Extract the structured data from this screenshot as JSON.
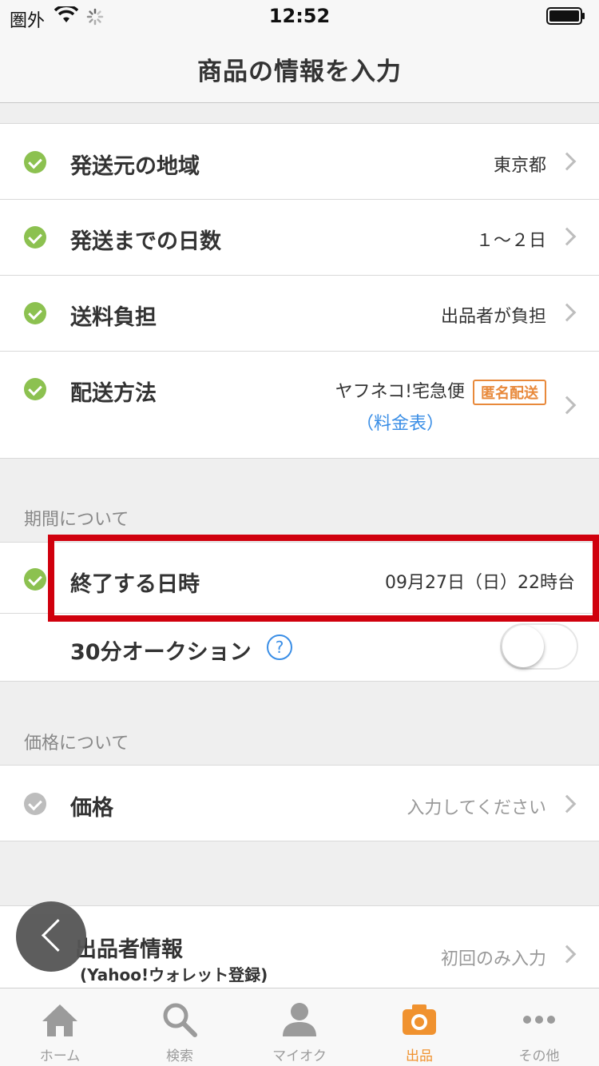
{
  "status": {
    "carrier": "圏外",
    "time": "12:52"
  },
  "nav": {
    "title": "商品の情報を入力"
  },
  "shipping": {
    "origin": {
      "label": "発送元の地域",
      "value": "東京都"
    },
    "days": {
      "label": "発送までの日数",
      "value": "１〜２日"
    },
    "fee": {
      "label": "送料負担",
      "value": "出品者が負担"
    },
    "method": {
      "label": "配送方法",
      "value": "ヤフネコ!宅急便",
      "badge": "匿名配送",
      "link": "（料金表）"
    }
  },
  "period": {
    "header": "期間について",
    "end": {
      "label": "終了する日時",
      "value": "09月27日（日）22時台"
    },
    "auction30": {
      "label": "30分オークション",
      "help": "?",
      "enabled": false
    }
  },
  "price": {
    "header": "価格について",
    "item": {
      "label": "価格",
      "placeholder": "入力してください"
    }
  },
  "seller": {
    "label": "出品者情報",
    "sublabel": "(Yahoo!ウォレット登録)",
    "value": "初回のみ入力"
  },
  "tabs": [
    {
      "label": "ホーム",
      "icon": "home-icon"
    },
    {
      "label": "検索",
      "icon": "search-icon"
    },
    {
      "label": "マイオク",
      "icon": "person-icon"
    },
    {
      "label": "出品",
      "icon": "camera-icon",
      "active": true
    },
    {
      "label": "その他",
      "icon": "more-icon"
    }
  ],
  "colors": {
    "accent": "#f0922f",
    "check": "#8cc150",
    "highlight": "#d0000d",
    "link": "#3a8ee6"
  }
}
